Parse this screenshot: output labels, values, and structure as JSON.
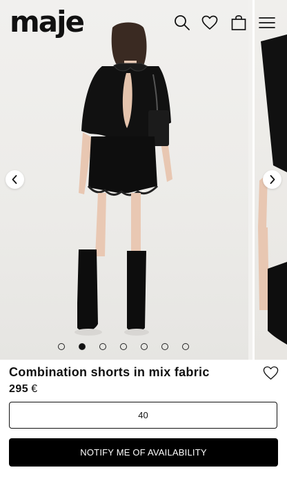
{
  "header": {
    "logo_text": "maje",
    "icons": [
      "search-icon",
      "heart-icon",
      "bag-icon",
      "menu-icon"
    ]
  },
  "gallery": {
    "slide_count": 7,
    "active_slide": 2,
    "prev_icon": "chevron-left-icon",
    "next_icon": "chevron-right-icon"
  },
  "product": {
    "title": "Combination shorts in mix fabric",
    "price": "295",
    "currency": "€",
    "wishlist_icon": "heart-outline-icon"
  },
  "size_selector": {
    "value": "40"
  },
  "cta": {
    "label": "NOTIFY ME OF AVAILABILITY",
    "background": "#000000",
    "text_color": "#ffffff"
  }
}
